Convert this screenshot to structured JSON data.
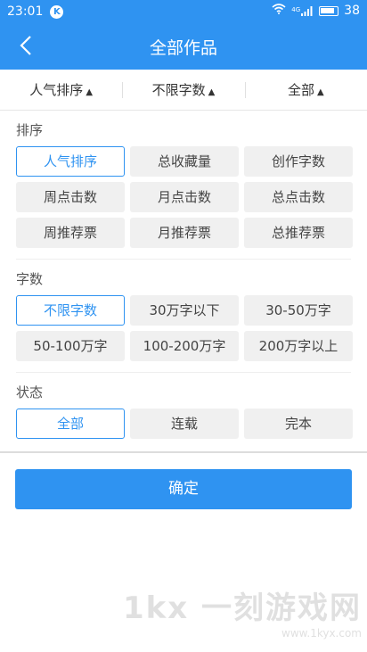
{
  "status": {
    "time": "23:01",
    "k_badge": "K",
    "signal": "4G",
    "battery": "38"
  },
  "header": {
    "title": "全部作品"
  },
  "filter_tabs": [
    {
      "label": "人气排序"
    },
    {
      "label": "不限字数"
    },
    {
      "label": "全部"
    }
  ],
  "sections": {
    "sort": {
      "title": "排序",
      "options": [
        "人气排序",
        "总收藏量",
        "创作字数",
        "周点击数",
        "月点击数",
        "总点击数",
        "周推荐票",
        "月推荐票",
        "总推荐票"
      ],
      "selected": "人气排序"
    },
    "words": {
      "title": "字数",
      "options": [
        "不限字数",
        "30万字以下",
        "30-50万字",
        "50-100万字",
        "100-200万字",
        "200万字以上"
      ],
      "selected": "不限字数"
    },
    "state": {
      "title": "状态",
      "options": [
        "全部",
        "连载",
        "完本"
      ],
      "selected": "全部"
    }
  },
  "confirm_label": "确定",
  "watermark": {
    "main": "1kx 一刻游戏网",
    "sub": "www.1kyx.com"
  },
  "colors": {
    "accent": "#2f93f1"
  }
}
